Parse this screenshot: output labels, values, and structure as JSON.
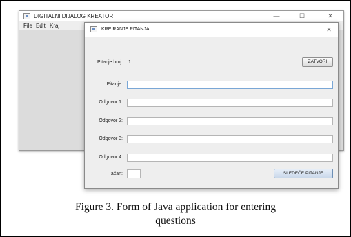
{
  "main_window": {
    "title": "DIGITALNI DIJALOG KREATOR",
    "controls": {
      "minimize": "—",
      "maximize": "☐",
      "close": "✕"
    },
    "menu": [
      "File",
      "Edit",
      "Kraj"
    ]
  },
  "dialog": {
    "title": "KREIRANJE PITANJA",
    "close": "✕",
    "question_number_label": "Pitanje broj:",
    "question_number_value": "1",
    "close_button": "ZATVORI",
    "question_label": "Pitanje:",
    "answers": [
      "Odgovor 1:",
      "Odgovor 2:",
      "Odgovor 3:",
      "Odgovor 4:"
    ],
    "correct_label": "Tačan:",
    "next_button": "SLEDEĆE PITANJE"
  },
  "caption": {
    "line1": "Figure 3.    Form of Java application for entering",
    "line2": "questions"
  },
  "icons": [
    "app-icon",
    "minimize-icon",
    "maximize-icon",
    "close-icon"
  ]
}
